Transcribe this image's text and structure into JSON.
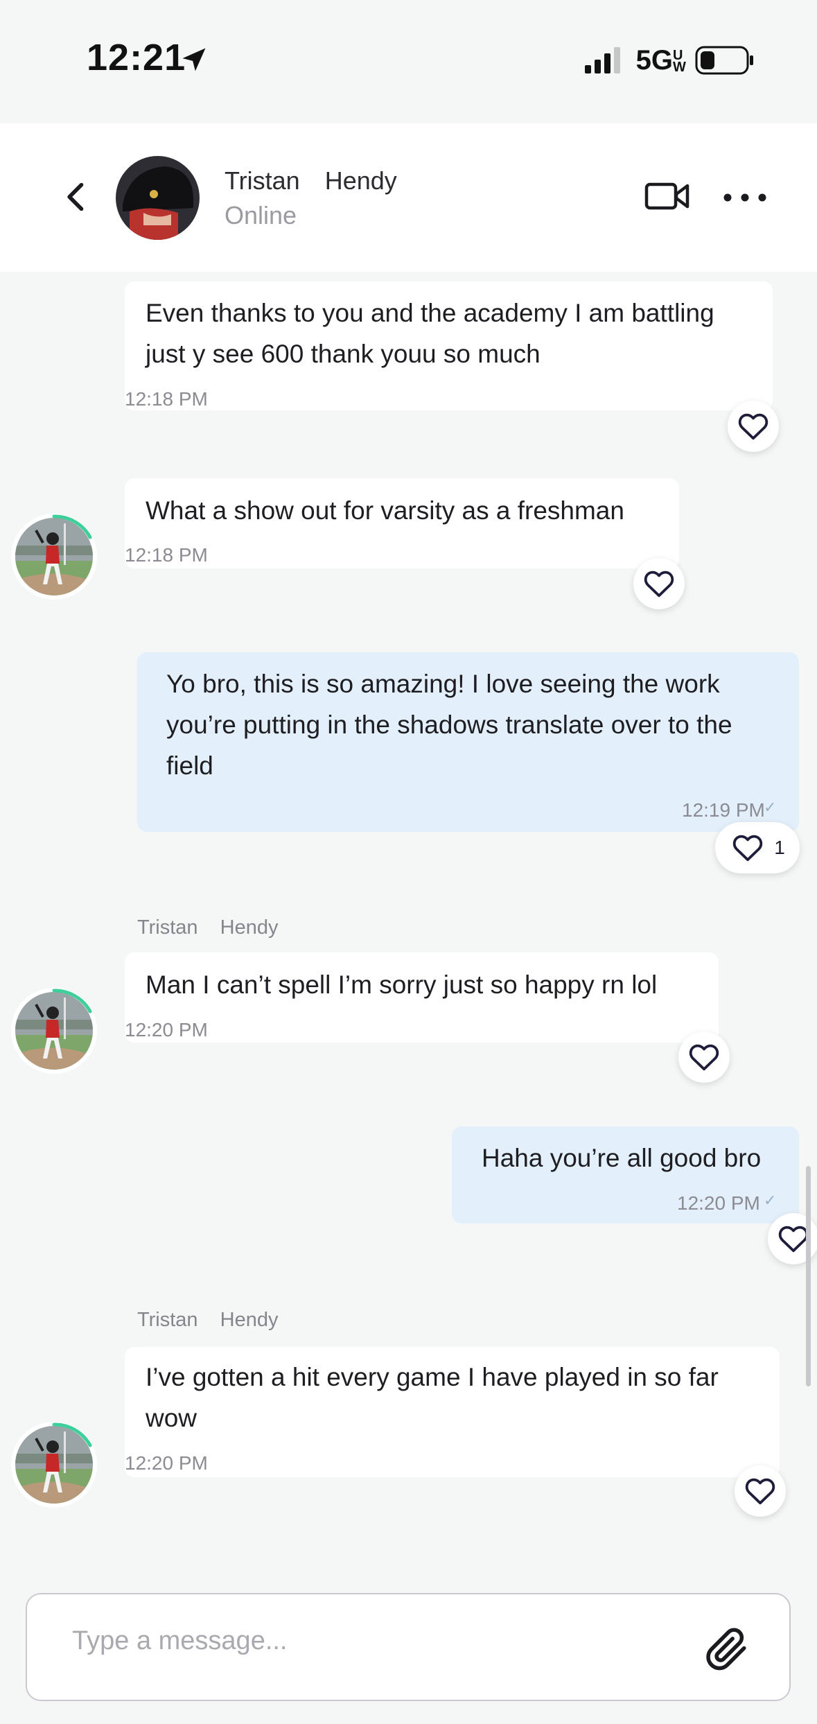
{
  "status_bar": {
    "time": "12:21",
    "network": "5G",
    "network_sub": "UW",
    "icons": [
      "location-arrow-icon",
      "signal-icon",
      "battery-icon"
    ]
  },
  "header": {
    "contact_name": "Tristan  Hendy",
    "status": "Online",
    "icons": [
      "back-chevron-icon",
      "video-camera-icon",
      "more-dots-icon"
    ]
  },
  "messages": [
    {
      "direction": "incoming",
      "lines": [
        "Even thanks to you and the academy I am battling",
        "just y see 600 thank youu so much"
      ],
      "time": "12:18 PM",
      "likes": ""
    },
    {
      "direction": "incoming",
      "lines": [
        "What a show out for varsity as a freshman"
      ],
      "time": "12:18 PM",
      "likes": ""
    },
    {
      "direction": "outgoing",
      "lines": [
        "Yo bro, this is so amazing! I love seeing the work",
        "you’re putting in the shadows translate over to the",
        "field"
      ],
      "time": "12:19 PM",
      "likes": "1"
    },
    {
      "direction": "incoming",
      "sender": "Tristan  Hendy",
      "lines": [
        "Man I can’t spell I’m sorry just so happy rn lol"
      ],
      "time": "12:20 PM",
      "likes": ""
    },
    {
      "direction": "outgoing",
      "lines": [
        "Haha you’re all good bro"
      ],
      "time": "12:20 PM",
      "likes": ""
    },
    {
      "direction": "incoming",
      "sender": "Tristan  Hendy",
      "lines": [
        "I’ve gotten a hit every game I have played in so far",
        "wow"
      ],
      "time": "12:20 PM",
      "likes": ""
    }
  ],
  "composer": {
    "placeholder": "Type a message...",
    "icon": "paperclip-icon"
  },
  "colors": {
    "incoming_bubble": "#ffffff",
    "outgoing_bubble": "#e3effa",
    "avatar_ring": "#3ecf9a",
    "background": "#f5f7f7"
  }
}
